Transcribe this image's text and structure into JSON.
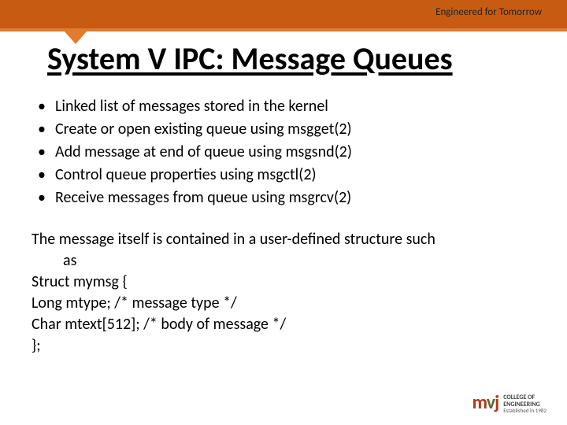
{
  "header": {
    "tagline": "Engineered for Tomorrow",
    "title": "System V IPC: Message Queues"
  },
  "bullets": [
    "Linked list of messages stored in the kernel",
    "Create or open existing queue using msgget(2)",
    "Add message at end of queue using msgsnd(2)",
    "Control queue properties using msgctl(2)",
    "Receive messages from queue using msgrcv(2)"
  ],
  "paragraph": {
    "lead": "The message itself is contained in a user-defined structure such",
    "lead_cont": "as",
    "lines": [
      "Struct mymsg {",
      "Long mtype; /* message type */",
      "Char mtext[512]; /* body of message */",
      "};"
    ]
  },
  "logo": {
    "mark_prefix": "m",
    "mark_dot": "v",
    "mark_suffix": "j",
    "line1": "COLLEGE OF",
    "line2": "ENGINEERING",
    "line3": "Established in 1982"
  }
}
